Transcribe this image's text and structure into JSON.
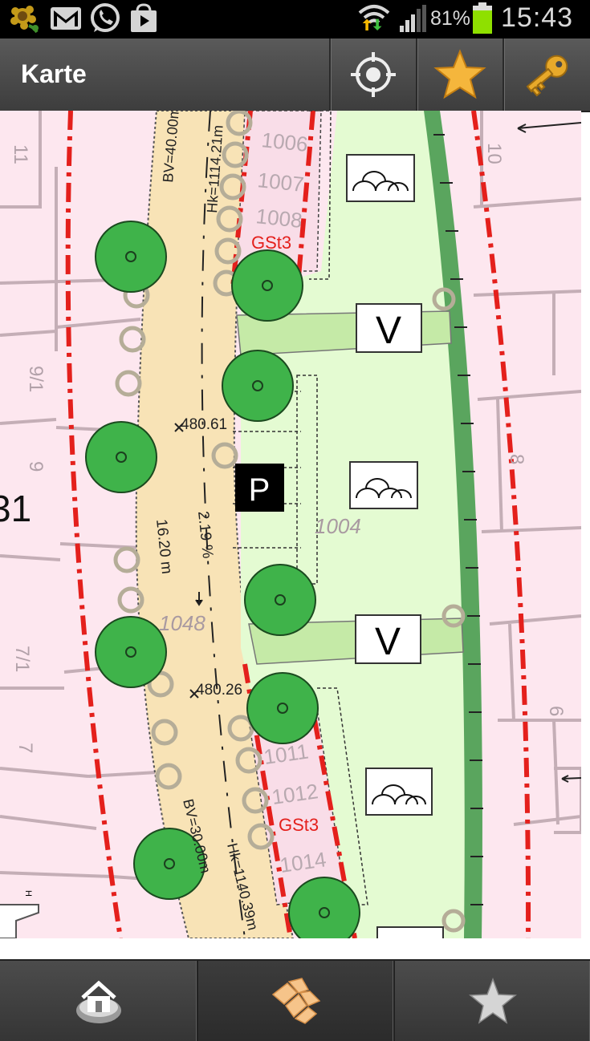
{
  "status_bar": {
    "icons": [
      "sunflower-app-icon",
      "gmail-icon",
      "whatsapp-icon",
      "play-store-icon",
      "wifi-icon",
      "signal-icon",
      "battery-icon"
    ],
    "battery": "81%",
    "time": "15:43",
    "battery_color": "#8fe000"
  },
  "action_bar": {
    "title": "Karte",
    "buttons": [
      "locate-icon",
      "favorite-star-icon",
      "key-icon"
    ],
    "star_color": "#f5b63c",
    "key_color": "#e8a92a"
  },
  "map": {
    "plot_numbers": [
      "11",
      "10",
      "9/1",
      "9",
      "8",
      "7/1",
      "7",
      "6",
      "31"
    ],
    "parcel_ids": [
      "1048",
      "1004"
    ],
    "road_labels": [
      "BV=40.00m",
      "Hk=1114.21m",
      "BV=30.00m",
      "Hk=1140.39m",
      "480.61",
      "480.26",
      "16.20 m",
      "2.19 %"
    ],
    "zone_labels": [
      "GSt3",
      "GSt3"
    ],
    "parking_label": "P",
    "marker_labels": [
      "V",
      "V"
    ],
    "colors": {
      "building_fill": "#fde7ef",
      "road_fill": "#f8e3b6",
      "green_fill": "#e4fbd2",
      "tree_fill": "#3fb34a",
      "boundary_red": "#e4201c",
      "hedge_green": "#5aa55e"
    }
  },
  "bottom_bar": {
    "buttons": [
      "home-icon",
      "map-tiles-icon",
      "favorites-star-icon"
    ],
    "active": "map-tiles-icon"
  }
}
